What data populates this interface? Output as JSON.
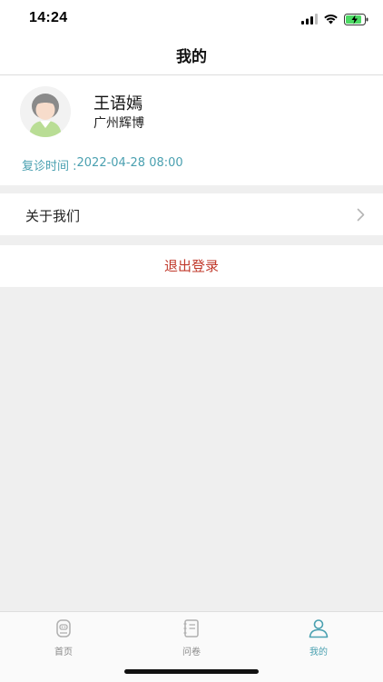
{
  "status_bar": {
    "time": "14:24"
  },
  "header": {
    "title": "我的"
  },
  "profile": {
    "name": "王语嫣",
    "organization": "广州辉博",
    "revisit_label": "复诊时间 :",
    "revisit_time": "2022-04-28 08:00"
  },
  "menu": {
    "about_label": "关于我们",
    "logout_label": "退出登录"
  },
  "tabbar": {
    "items": [
      {
        "label": "首页",
        "icon": "home-robot-icon"
      },
      {
        "label": "问卷",
        "icon": "notebook-icon"
      },
      {
        "label": "我的",
        "icon": "person-icon",
        "active": true
      }
    ]
  },
  "colors": {
    "accent": "#4aa0b0",
    "logout": "#c0392b",
    "background": "#efefef"
  }
}
